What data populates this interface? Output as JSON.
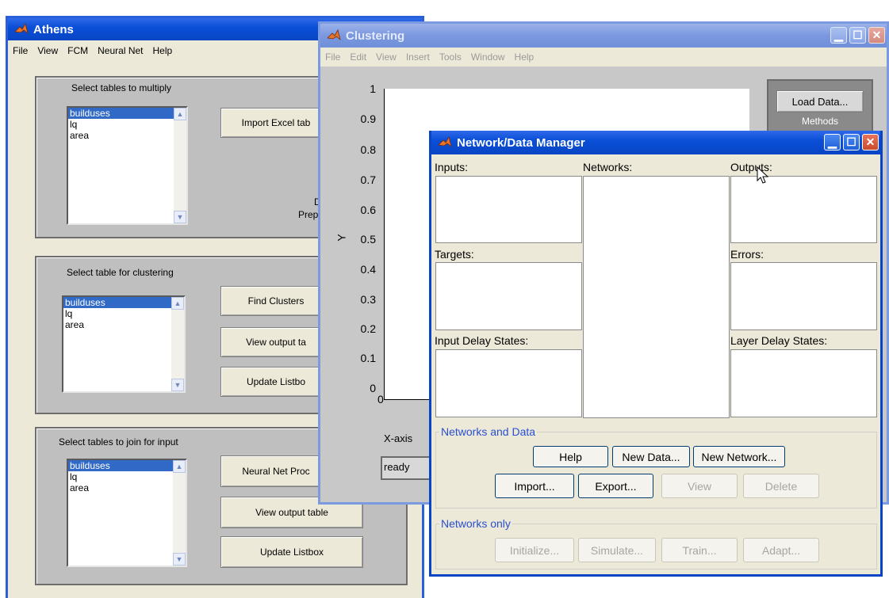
{
  "athens": {
    "title": "Athens",
    "menu": [
      "File",
      "View",
      "FCM",
      "Neural Net",
      "Help"
    ],
    "panel1": {
      "title": "Select tables to multiply",
      "list": [
        "builduses",
        "lq",
        "area"
      ],
      "button": "Import Excel tab",
      "text1": "Da",
      "text2": "Prepro"
    },
    "panel2": {
      "title": "Select table for clustering",
      "list": [
        "builduses",
        "lq",
        "area"
      ],
      "buttons": [
        "Find Clusters",
        "View output ta",
        "Update Listbo"
      ]
    },
    "panel3": {
      "title": "Select tables to join for input",
      "list": [
        "builduses",
        "lq",
        "area"
      ],
      "buttons": [
        "Neural Net Proc",
        "View output table",
        "Update Listbox"
      ]
    }
  },
  "clustering": {
    "title": "Clustering",
    "menu": [
      "File",
      "Edit",
      "View",
      "Insert",
      "Tools",
      "Window",
      "Help"
    ],
    "y_ticks": [
      "1",
      "0.9",
      "0.8",
      "0.7",
      "0.6",
      "0.5",
      "0.4",
      "0.3",
      "0.2",
      "0.1",
      "0"
    ],
    "x_tick0": "0",
    "ylabel": "Y",
    "xlabel": "X-axis",
    "status": "ready",
    "load_button": "Load Data...",
    "methods_label": "Methods"
  },
  "manager": {
    "title": "Network/Data Manager",
    "labels": {
      "inputs": "Inputs:",
      "networks": "Networks:",
      "outputs": "Outputs:",
      "targets": "Targets:",
      "errors": "Errors:",
      "input_delay": "Input Delay States:",
      "layer_delay": "Layer Delay States:"
    },
    "group1": "Networks and Data",
    "group2": "Networks only",
    "buttons": {
      "help": "Help",
      "new_data": "New Data...",
      "new_network": "New Network...",
      "import": "Import...",
      "export": "Export...",
      "view": "View",
      "delete": "Delete",
      "initialize": "Initialize...",
      "simulate": "Simulate...",
      "train": "Train...",
      "adapt": "Adapt..."
    }
  },
  "icons": {
    "matlab": "matlab-logo-icon",
    "cursor": "mouse-pointer-icon"
  }
}
